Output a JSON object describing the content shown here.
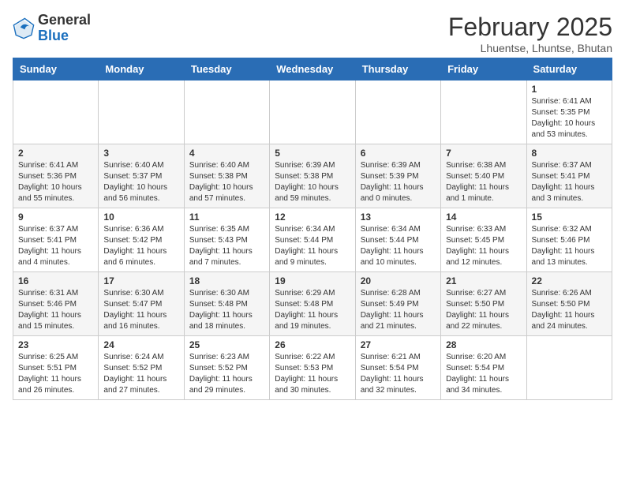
{
  "header": {
    "logo_general": "General",
    "logo_blue": "Blue",
    "month_year": "February 2025",
    "location": "Lhuentse, Lhuntse, Bhutan"
  },
  "days_of_week": [
    "Sunday",
    "Monday",
    "Tuesday",
    "Wednesday",
    "Thursday",
    "Friday",
    "Saturday"
  ],
  "weeks": [
    [
      {
        "day": "",
        "info": ""
      },
      {
        "day": "",
        "info": ""
      },
      {
        "day": "",
        "info": ""
      },
      {
        "day": "",
        "info": ""
      },
      {
        "day": "",
        "info": ""
      },
      {
        "day": "",
        "info": ""
      },
      {
        "day": "1",
        "info": "Sunrise: 6:41 AM\nSunset: 5:35 PM\nDaylight: 10 hours and 53 minutes."
      }
    ],
    [
      {
        "day": "2",
        "info": "Sunrise: 6:41 AM\nSunset: 5:36 PM\nDaylight: 10 hours and 55 minutes."
      },
      {
        "day": "3",
        "info": "Sunrise: 6:40 AM\nSunset: 5:37 PM\nDaylight: 10 hours and 56 minutes."
      },
      {
        "day": "4",
        "info": "Sunrise: 6:40 AM\nSunset: 5:38 PM\nDaylight: 10 hours and 57 minutes."
      },
      {
        "day": "5",
        "info": "Sunrise: 6:39 AM\nSunset: 5:38 PM\nDaylight: 10 hours and 59 minutes."
      },
      {
        "day": "6",
        "info": "Sunrise: 6:39 AM\nSunset: 5:39 PM\nDaylight: 11 hours and 0 minutes."
      },
      {
        "day": "7",
        "info": "Sunrise: 6:38 AM\nSunset: 5:40 PM\nDaylight: 11 hours and 1 minute."
      },
      {
        "day": "8",
        "info": "Sunrise: 6:37 AM\nSunset: 5:41 PM\nDaylight: 11 hours and 3 minutes."
      }
    ],
    [
      {
        "day": "9",
        "info": "Sunrise: 6:37 AM\nSunset: 5:41 PM\nDaylight: 11 hours and 4 minutes."
      },
      {
        "day": "10",
        "info": "Sunrise: 6:36 AM\nSunset: 5:42 PM\nDaylight: 11 hours and 6 minutes."
      },
      {
        "day": "11",
        "info": "Sunrise: 6:35 AM\nSunset: 5:43 PM\nDaylight: 11 hours and 7 minutes."
      },
      {
        "day": "12",
        "info": "Sunrise: 6:34 AM\nSunset: 5:44 PM\nDaylight: 11 hours and 9 minutes."
      },
      {
        "day": "13",
        "info": "Sunrise: 6:34 AM\nSunset: 5:44 PM\nDaylight: 11 hours and 10 minutes."
      },
      {
        "day": "14",
        "info": "Sunrise: 6:33 AM\nSunset: 5:45 PM\nDaylight: 11 hours and 12 minutes."
      },
      {
        "day": "15",
        "info": "Sunrise: 6:32 AM\nSunset: 5:46 PM\nDaylight: 11 hours and 13 minutes."
      }
    ],
    [
      {
        "day": "16",
        "info": "Sunrise: 6:31 AM\nSunset: 5:46 PM\nDaylight: 11 hours and 15 minutes."
      },
      {
        "day": "17",
        "info": "Sunrise: 6:30 AM\nSunset: 5:47 PM\nDaylight: 11 hours and 16 minutes."
      },
      {
        "day": "18",
        "info": "Sunrise: 6:30 AM\nSunset: 5:48 PM\nDaylight: 11 hours and 18 minutes."
      },
      {
        "day": "19",
        "info": "Sunrise: 6:29 AM\nSunset: 5:48 PM\nDaylight: 11 hours and 19 minutes."
      },
      {
        "day": "20",
        "info": "Sunrise: 6:28 AM\nSunset: 5:49 PM\nDaylight: 11 hours and 21 minutes."
      },
      {
        "day": "21",
        "info": "Sunrise: 6:27 AM\nSunset: 5:50 PM\nDaylight: 11 hours and 22 minutes."
      },
      {
        "day": "22",
        "info": "Sunrise: 6:26 AM\nSunset: 5:50 PM\nDaylight: 11 hours and 24 minutes."
      }
    ],
    [
      {
        "day": "23",
        "info": "Sunrise: 6:25 AM\nSunset: 5:51 PM\nDaylight: 11 hours and 26 minutes."
      },
      {
        "day": "24",
        "info": "Sunrise: 6:24 AM\nSunset: 5:52 PM\nDaylight: 11 hours and 27 minutes."
      },
      {
        "day": "25",
        "info": "Sunrise: 6:23 AM\nSunset: 5:52 PM\nDaylight: 11 hours and 29 minutes."
      },
      {
        "day": "26",
        "info": "Sunrise: 6:22 AM\nSunset: 5:53 PM\nDaylight: 11 hours and 30 minutes."
      },
      {
        "day": "27",
        "info": "Sunrise: 6:21 AM\nSunset: 5:54 PM\nDaylight: 11 hours and 32 minutes."
      },
      {
        "day": "28",
        "info": "Sunrise: 6:20 AM\nSunset: 5:54 PM\nDaylight: 11 hours and 34 minutes."
      },
      {
        "day": "",
        "info": ""
      }
    ]
  ]
}
